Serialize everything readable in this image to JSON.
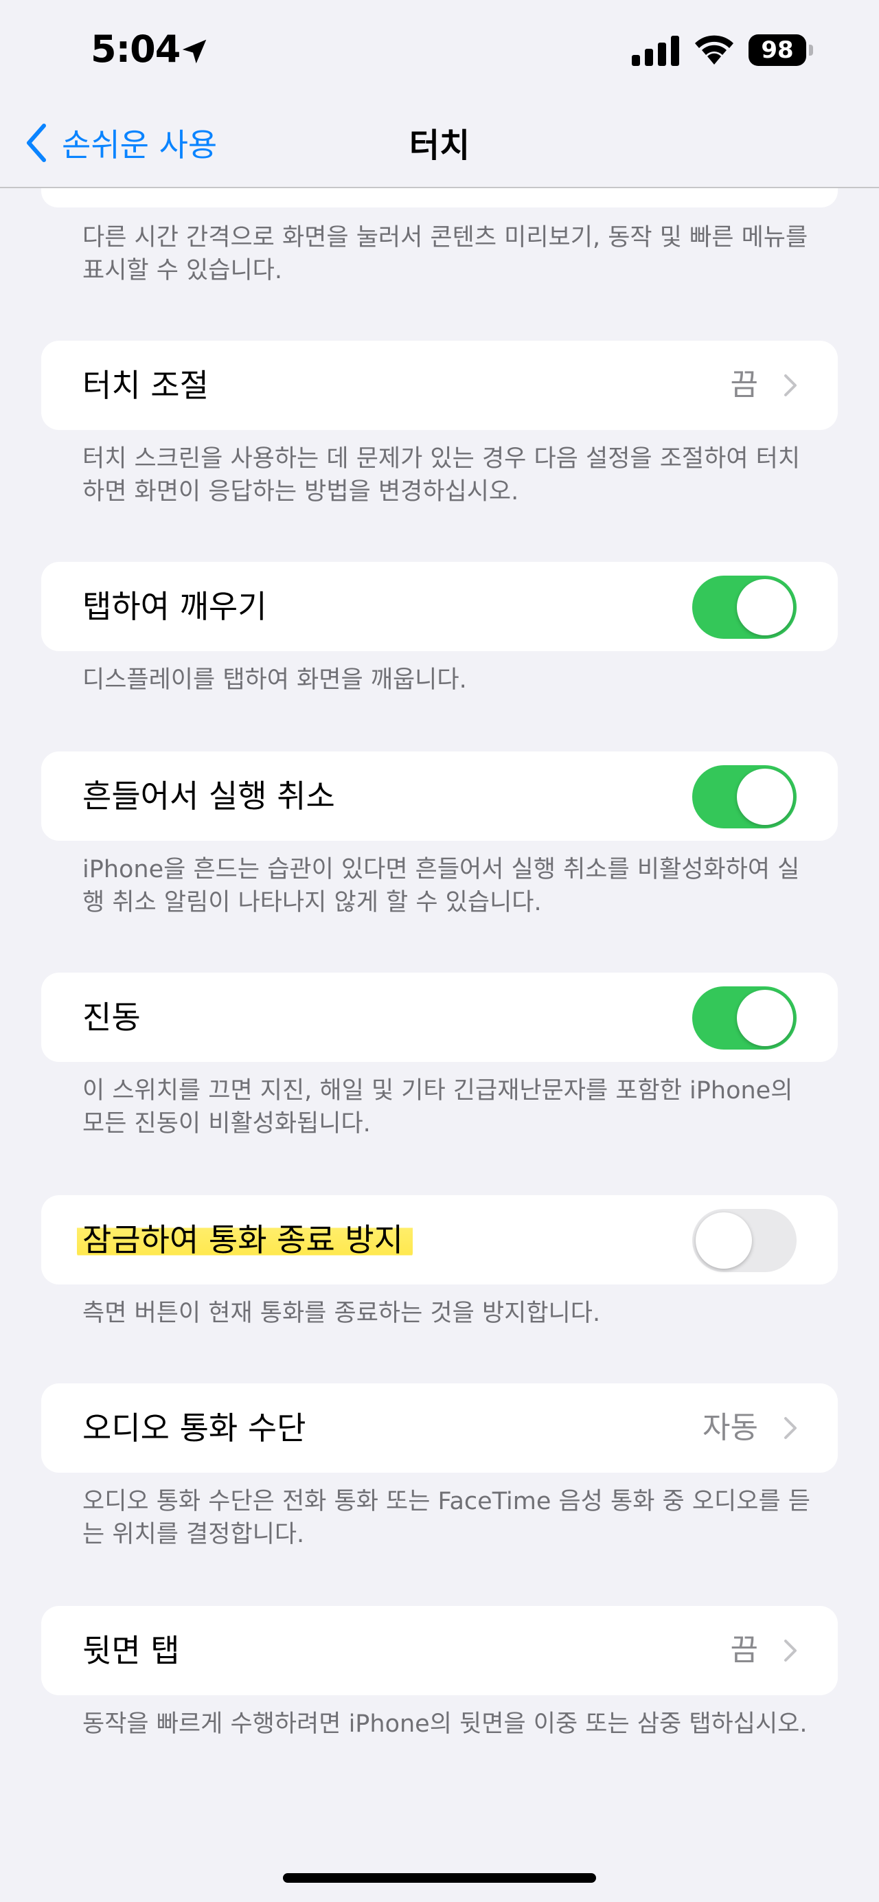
{
  "status_bar": {
    "time": "5:04",
    "battery": "98",
    "icons": [
      "location-arrow-icon",
      "cellular-signal-icon",
      "wifi-icon",
      "battery-icon"
    ]
  },
  "nav": {
    "back_label": "손쉬운 사용",
    "title": "터치"
  },
  "colors": {
    "accent": "#0a84ff",
    "toggle_on": "#34c759",
    "toggle_off": "#e9e9eb",
    "highlight": "#ffe85a",
    "background": "#f2f2f7"
  },
  "intro_footer": "다른 시간 간격으로 화면을 눌러서 콘텐츠 미리보기, 동작 및 빠른 메뉴를 표시할 수 있습니다.",
  "sections": [
    {
      "label": "터치 조절",
      "value": "끔",
      "control": "chevron",
      "footer": "터치 스크린을 사용하는 데 문제가 있는 경우 다음 설정을 조절하여 터치하면 화면이 응답하는 방법을 변경하십시오."
    },
    {
      "label": "탭하여 깨우기",
      "control": "toggle",
      "toggle_on": true,
      "footer": "디스플레이를 탭하여 화면을 깨웁니다."
    },
    {
      "label": "흔들어서 실행 취소",
      "control": "toggle",
      "toggle_on": true,
      "footer": "iPhone을 흔드는 습관이 있다면 흔들어서 실행 취소를 비활성화하여 실행 취소 알림이 나타나지 않게 할 수 있습니다."
    },
    {
      "label": "진동",
      "control": "toggle",
      "toggle_on": true,
      "footer": "이 스위치를 끄면 지진, 해일 및 기타 긴급재난문자를 포함한 iPhone의 모든 진동이 비활성화됩니다."
    },
    {
      "label": "잠금하여 통화 종료 방지",
      "control": "toggle",
      "toggle_on": false,
      "highlighted": true,
      "footer": "측면 버튼이 현재 통화를 종료하는 것을 방지합니다."
    },
    {
      "label": "오디오 통화 수단",
      "value": "자동",
      "control": "chevron",
      "footer": "오디오 통화 수단은 전화 통화 또는 FaceTime 음성 통화 중 오디오를 듣는 위치를 결정합니다."
    },
    {
      "label": "뒷면 탭",
      "value": "끔",
      "control": "chevron",
      "footer": "동작을 빠르게 수행하려면 iPhone의 뒷면을 이중 또는 삼중 탭하십시오."
    }
  ]
}
